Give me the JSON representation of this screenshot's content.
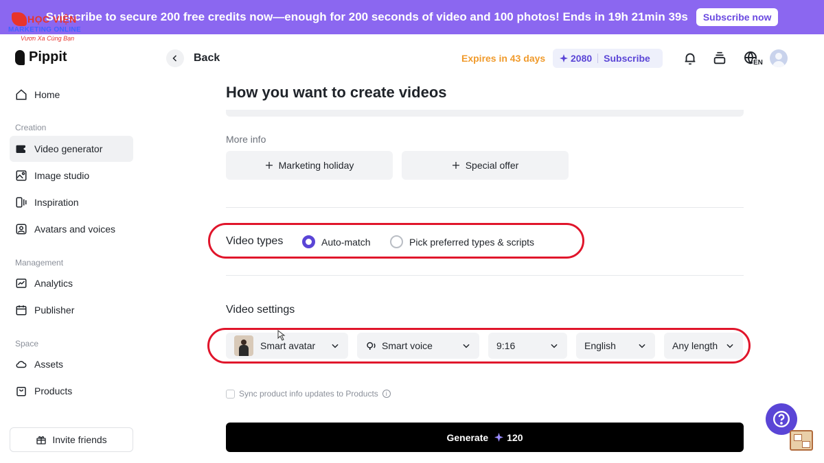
{
  "banner": {
    "text": "Subscribe to secure 200 free credits now—enough for 200 seconds of video and 100 photos! Ends in 19h 21min 39s",
    "button": "Subscribe now"
  },
  "watermark": {
    "line1": "HỌC VIỆN",
    "line2": "MARKETING ONLINE",
    "line3": "Vươn Xa Cùng Bạn"
  },
  "brand": {
    "name": "Pippit"
  },
  "sidebar": {
    "items": [
      {
        "label": "Home",
        "icon": "home-icon"
      },
      {
        "label": "Video generator",
        "icon": "video-icon",
        "active": true
      },
      {
        "label": "Image studio",
        "icon": "image-icon"
      },
      {
        "label": "Inspiration",
        "icon": "inspiration-icon"
      },
      {
        "label": "Avatars and voices",
        "icon": "avatar-icon"
      },
      {
        "label": "Analytics",
        "icon": "analytics-icon"
      },
      {
        "label": "Publisher",
        "icon": "calendar-icon"
      },
      {
        "label": "Assets",
        "icon": "cloud-icon"
      },
      {
        "label": "Products",
        "icon": "bag-icon"
      }
    ],
    "sections": {
      "creation": "Creation",
      "management": "Management",
      "space": "Space"
    },
    "invite": "Invite friends"
  },
  "header": {
    "back": "Back",
    "expires": "Expires in 43 days",
    "credits": "2080",
    "subscribe": "Subscribe",
    "language": "EN"
  },
  "main": {
    "title": "How you want to create videos",
    "more_info_label": "More info",
    "chips": [
      "Marketing holiday",
      "Special offer"
    ],
    "video_types": {
      "label": "Video types",
      "options": [
        {
          "label": "Auto-match",
          "selected": true
        },
        {
          "label": "Pick preferred types & scripts",
          "selected": false
        }
      ]
    },
    "video_settings": {
      "label": "Video settings",
      "avatar": "Smart avatar",
      "voice": "Smart voice",
      "ratio": "9:16",
      "language": "English",
      "length": "Any length"
    },
    "sync_label": "Sync product info updates to Products",
    "generate_label": "Generate",
    "generate_cost": "120"
  },
  "colors": {
    "accent": "#5a45d6",
    "banner": "#8b67f0",
    "highlight": "#e0152b",
    "expires": "#f09a2b"
  }
}
